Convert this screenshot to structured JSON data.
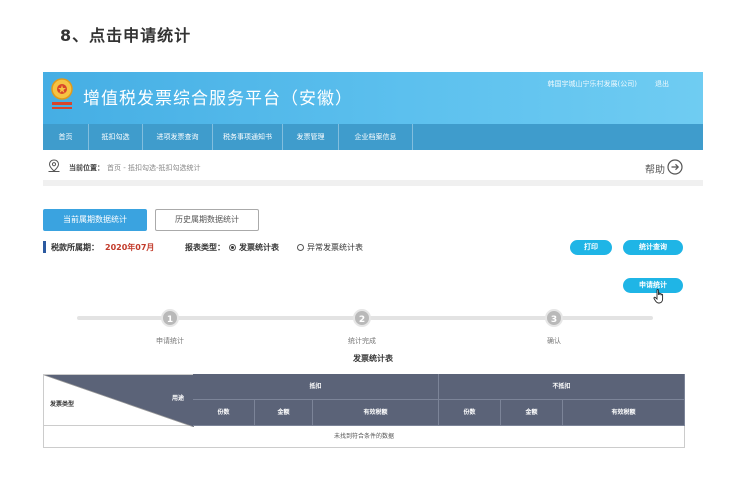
{
  "step_heading": "8、点击申请统计",
  "header": {
    "app_title": "增值税发票综合服务平台（安徽）",
    "user_info": "韩国宇城山宁乐村发展(公司)",
    "logout": "退出"
  },
  "nav": {
    "items": [
      {
        "label": "首页"
      },
      {
        "label": "抵扣勾选"
      },
      {
        "label": "进项发票查询"
      },
      {
        "label": "税务事项通知书"
      },
      {
        "label": "发票管理"
      },
      {
        "label": "企业档案信息"
      }
    ]
  },
  "breadcrumb": {
    "label": "当前位置：",
    "path": "首页 - 抵扣勾选-抵扣勾选统计",
    "help": "帮助"
  },
  "tabs": {
    "current": "当前属期数据统计",
    "history": "历史属期数据统计"
  },
  "filters": {
    "period_label": "税款所属期：",
    "period_value": "2020年07月",
    "type_label": "报表类型：",
    "option_normal": "发票统计表",
    "option_abnormal": "异常发票统计表",
    "selected": "发票统计表"
  },
  "actions": {
    "print": "打印",
    "query": "统计查询",
    "apply": "申请统计"
  },
  "steps": [
    {
      "number": "1",
      "label": "申请统计"
    },
    {
      "number": "2",
      "label": "统计完成"
    },
    {
      "number": "3",
      "label": "确认"
    }
  ],
  "table": {
    "title": "发票统计表",
    "corner_use": "用途",
    "corner_type": "发票类型",
    "group_deduct": "抵扣",
    "group_nodeduct": "不抵扣",
    "cols": [
      "份数",
      "金额",
      "有效税额",
      "份数",
      "金额",
      "有效税额"
    ],
    "empty_text": "未找到符合条件的数据"
  },
  "colors": {
    "banner": "#45aee4",
    "navbar": "#3f9ccc",
    "accent": "#3aa3e0",
    "pill": "#1fb5e6",
    "period": "#c23a2a",
    "table_header": "#5b6378"
  }
}
